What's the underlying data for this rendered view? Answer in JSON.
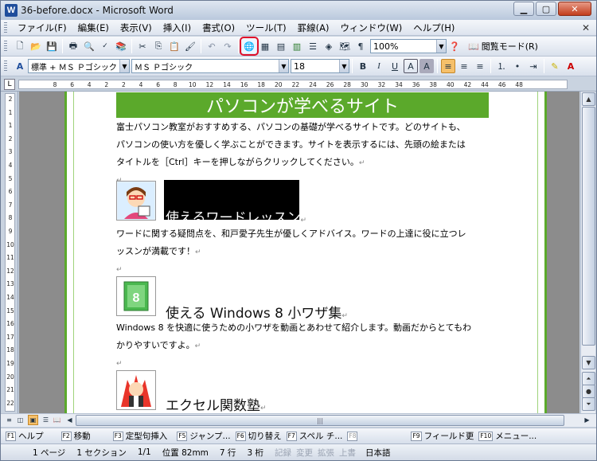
{
  "window": {
    "title": "36-before.docx - Microsoft Word",
    "app_icon": "W"
  },
  "menubar": {
    "items": [
      "ファイル(F)",
      "編集(E)",
      "表示(V)",
      "挿入(I)",
      "書式(O)",
      "ツール(T)",
      "罫線(A)",
      "ウィンドウ(W)",
      "ヘルプ(H)"
    ]
  },
  "toolbar1": {
    "zoom": "100%",
    "reading_mode": "閲覧モード(R)"
  },
  "toolbar2": {
    "style": "標準 + ＭＳ Ｐゴシック",
    "font": "ＭＳ Ｐゴシック",
    "size": "18",
    "bold": "B",
    "italic": "I",
    "underline": "U",
    "char_border": "A",
    "char_shade": "A",
    "font_color": "A"
  },
  "ruler": {
    "tab": "L",
    "numbers": [
      "8",
      "6",
      "4",
      "2",
      "2",
      "4",
      "6",
      "8",
      "10",
      "12",
      "14",
      "16",
      "18",
      "20",
      "22",
      "24",
      "26",
      "28",
      "30",
      "32",
      "34",
      "36",
      "38",
      "40",
      "42",
      "44",
      "46",
      "48"
    ]
  },
  "vruler": {
    "numbers": [
      "2",
      "1",
      "1",
      "2",
      "3",
      "4",
      "5",
      "6",
      "7",
      "8",
      "9",
      "10",
      "11",
      "12",
      "13",
      "14",
      "15",
      "16",
      "17",
      "18",
      "19",
      "20",
      "21",
      "22"
    ]
  },
  "document": {
    "banner": "パソコンが学べるサイト",
    "intro_lines": [
      "富士パソコン教室がおすすめする、パソコンの基礎が学べるサイトです。どのサイトも、",
      "パソコンの使い方を優しく学ぶことができます。サイトを表示するには、先頭の絵または",
      "タイトルを［Ctrl］キーを押しながらクリックしてください。"
    ],
    "sections": [
      {
        "heading": "使えるワードレッスン",
        "lines": [
          "ワードに関する疑問点を、和戸愛子先生が優しくアドバイス。ワードの上達に役に立つレ",
          "ッスンが満載です！"
        ]
      },
      {
        "heading": "使える Windows 8 小ワザ集",
        "icon_text": "8",
        "lines": [
          "Windows 8 を快適に使うための小ワザを動画とあわせて紹介します。動画だからとてもわ",
          "かりやすいですよ。"
        ]
      },
      {
        "heading": "エクセル関数塾"
      }
    ],
    "para_mark": "↵"
  },
  "fkeys": [
    {
      "key": "F1",
      "label": "ヘルプ"
    },
    {
      "key": "F2",
      "label": "移動"
    },
    {
      "key": "F3",
      "label": "定型句挿入"
    },
    {
      "key": "F5",
      "label": "ジャンプ..."
    },
    {
      "key": "F6",
      "label": "切り替え"
    },
    {
      "key": "F7",
      "label": "スペル チ..."
    },
    {
      "key": "F8",
      "label": ""
    },
    {
      "key": "F9",
      "label": "フィールド更"
    },
    {
      "key": "F10",
      "label": "メニュー..."
    }
  ],
  "status": {
    "page": "1 ページ",
    "section": "1 セクション",
    "pages": "1/1",
    "position": "位置 82mm",
    "line": "7 行",
    "column": "3 桁",
    "rec": "記録",
    "trk": "変更",
    "ext": "拡張",
    "ovr": "上書",
    "lang": "日本語"
  }
}
